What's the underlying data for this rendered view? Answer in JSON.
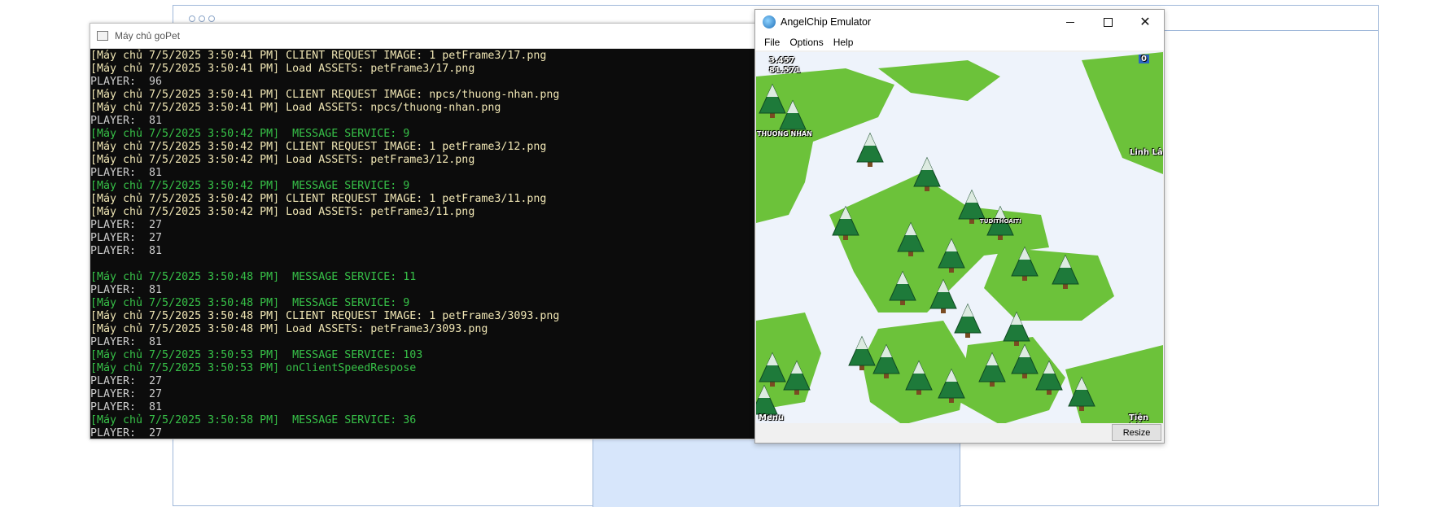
{
  "console": {
    "title": "Máy chủ goPet",
    "lines": [
      {
        "type": "info",
        "text": "[Máy chủ 7/5/2025 3:50:41 PM] CLIENT REQUEST IMAGE: 1 petFrame3/17.png"
      },
      {
        "type": "info",
        "text": "[Máy chủ 7/5/2025 3:50:41 PM] Load ASSETS: petFrame3/17.png"
      },
      {
        "type": "player",
        "text": "PLAYER:  96"
      },
      {
        "type": "info",
        "text": "[Máy chủ 7/5/2025 3:50:41 PM] CLIENT REQUEST IMAGE: npcs/thuong-nhan.png"
      },
      {
        "type": "info",
        "text": "[Máy chủ 7/5/2025 3:50:41 PM] Load ASSETS: npcs/thuong-nhan.png"
      },
      {
        "type": "player",
        "text": "PLAYER:  81"
      },
      {
        "type": "msg",
        "text": "[Máy chủ 7/5/2025 3:50:42 PM]  MESSAGE SERVICE: 9"
      },
      {
        "type": "info",
        "text": "[Máy chủ 7/5/2025 3:50:42 PM] CLIENT REQUEST IMAGE: 1 petFrame3/12.png"
      },
      {
        "type": "info",
        "text": "[Máy chủ 7/5/2025 3:50:42 PM] Load ASSETS: petFrame3/12.png"
      },
      {
        "type": "player",
        "text": "PLAYER:  81"
      },
      {
        "type": "msg",
        "text": "[Máy chủ 7/5/2025 3:50:42 PM]  MESSAGE SERVICE: 9"
      },
      {
        "type": "info",
        "text": "[Máy chủ 7/5/2025 3:50:42 PM] CLIENT REQUEST IMAGE: 1 petFrame3/11.png"
      },
      {
        "type": "info",
        "text": "[Máy chủ 7/5/2025 3:50:42 PM] Load ASSETS: petFrame3/11.png"
      },
      {
        "type": "player",
        "text": "PLAYER:  27"
      },
      {
        "type": "player",
        "text": "PLAYER:  27"
      },
      {
        "type": "player",
        "text": "PLAYER:  81"
      },
      {
        "type": "blank",
        "text": ""
      },
      {
        "type": "msg",
        "text": "[Máy chủ 7/5/2025 3:50:48 PM]  MESSAGE SERVICE: 11"
      },
      {
        "type": "player",
        "text": "PLAYER:  81"
      },
      {
        "type": "msg",
        "text": "[Máy chủ 7/5/2025 3:50:48 PM]  MESSAGE SERVICE: 9"
      },
      {
        "type": "info",
        "text": "[Máy chủ 7/5/2025 3:50:48 PM] CLIENT REQUEST IMAGE: 1 petFrame3/3093.png"
      },
      {
        "type": "info",
        "text": "[Máy chủ 7/5/2025 3:50:48 PM] Load ASSETS: petFrame3/3093.png"
      },
      {
        "type": "player",
        "text": "PLAYER:  81"
      },
      {
        "type": "msg",
        "text": "[Máy chủ 7/5/2025 3:50:53 PM]  MESSAGE SERVICE: 103"
      },
      {
        "type": "msg",
        "text": "[Máy chủ 7/5/2025 3:50:53 PM] onClientSpeedRespose"
      },
      {
        "type": "player",
        "text": "PLAYER:  27"
      },
      {
        "type": "player",
        "text": "PLAYER:  27"
      },
      {
        "type": "player",
        "text": "PLAYER:  81"
      },
      {
        "type": "msg",
        "text": "[Máy chủ 7/5/2025 3:50:58 PM]  MESSAGE SERVICE: 36"
      },
      {
        "type": "player",
        "text": "PLAYER:  27"
      }
    ]
  },
  "emulator": {
    "title": "AngelChip Emulator",
    "menu": [
      "File",
      "Options",
      "Help"
    ],
    "minimize_icon": "minimize-icon",
    "maximize_icon": "maximize-icon",
    "close_icon": "close-icon",
    "close_glyph": "✕",
    "resize_label": "Resize",
    "game": {
      "gold": "3.457",
      "gems": "81.571",
      "counter": "0",
      "location": "Linh Lâ",
      "npc_name": "THUONG NHAN",
      "player_name": "TUDITHOAITI",
      "menu_label": "Menu",
      "util_label": "Tiện ích",
      "badge": "0"
    }
  },
  "colors": {
    "console_bg": "#0c0c0c",
    "console_info": "#f0e6b4",
    "console_msg": "#37c148",
    "grass": "#6cc23a",
    "snow": "#eef3fb"
  }
}
